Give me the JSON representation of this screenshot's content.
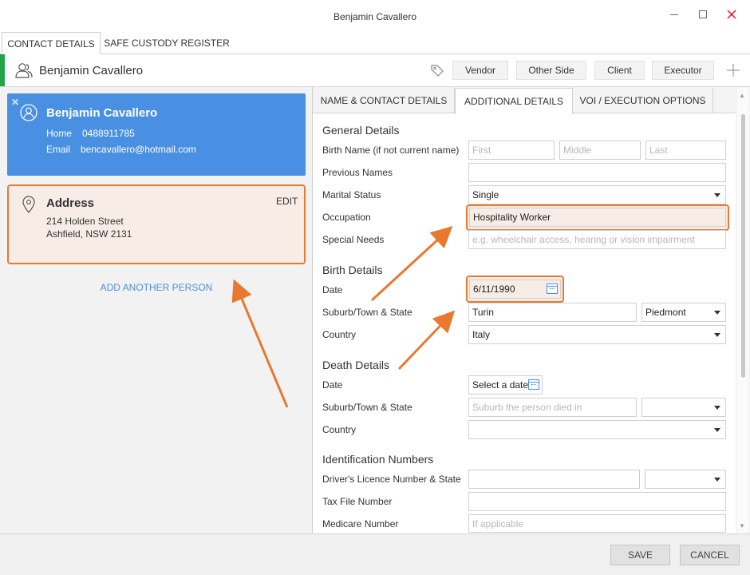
{
  "window": {
    "title": "Benjamin Cavallero",
    "minimize_icon": "minimize-icon",
    "maximize_icon": "maximize-icon",
    "close_icon": "close-icon",
    "close_color": "#e81123"
  },
  "top_tabs": [
    {
      "label": "CONTACT DETAILS",
      "active": true
    },
    {
      "label": "SAFE CUSTODY REGISTER",
      "active": false
    }
  ],
  "person_header": {
    "icon": "people-icon",
    "name": "Benjamin Cavallero",
    "accent_color": "#22a447",
    "tag_icon": "tag-icon",
    "roles": [
      "Vendor",
      "Other Side",
      "Client",
      "Executor"
    ],
    "add_icon": "plus-icon"
  },
  "contact_card": {
    "icon": "user-circle-icon",
    "remove_icon": "close-icon",
    "name": "Benjamin Cavallero",
    "home_label": "Home",
    "home_value": "0488911785",
    "email_label": "Email",
    "email_value": "bencavallero@hotmail.com",
    "color": "#4a90e2"
  },
  "address_card": {
    "icon": "map-pin-icon",
    "title": "Address",
    "edit_label": "EDIT",
    "line1": "214 Holden Street",
    "line2": "Ashfield, NSW 2131"
  },
  "add_another_person": "ADD ANOTHER PERSON",
  "sub_tabs": [
    {
      "label": "NAME & CONTACT DETAILS",
      "active": false
    },
    {
      "label": "ADDITIONAL DETAILS",
      "active": true
    },
    {
      "label": "VOI / EXECUTION OPTIONS",
      "active": false
    }
  ],
  "general": {
    "heading": "General Details",
    "birth_name_label": "Birth Name (if not current name)",
    "first_placeholder": "First",
    "middle_placeholder": "Middle",
    "last_placeholder": "Last",
    "previous_names_label": "Previous Names",
    "previous_names_value": "",
    "marital_status_label": "Marital Status",
    "marital_status_value": "Single",
    "occupation_label": "Occupation",
    "occupation_value": "Hospitality Worker",
    "special_needs_label": "Special Needs",
    "special_needs_placeholder": "e.g. wheelchair access, hearing or vision impairment"
  },
  "birth": {
    "heading": "Birth Details",
    "date_label": "Date",
    "date_value": "6/11/1990",
    "suburb_label": "Suburb/Town & State",
    "suburb_value": "Turin",
    "state_value": "Piedmont",
    "country_label": "Country",
    "country_value": "Italy"
  },
  "death": {
    "heading": "Death Details",
    "date_label": "Date",
    "date_button": "Select a date",
    "suburb_label": "Suburb/Town & State",
    "suburb_placeholder": "Suburb the person died in",
    "state_value": "",
    "country_label": "Country",
    "country_value": ""
  },
  "identification": {
    "heading": "Identification Numbers",
    "licence_label": "Driver's Licence Number & State",
    "licence_value": "",
    "licence_state": "",
    "tfn_label": "Tax File Number",
    "tfn_value": "",
    "medicare_label": "Medicare Number",
    "medicare_placeholder": "If applicable"
  },
  "footer": {
    "save_label": "SAVE",
    "cancel_label": "CANCEL"
  },
  "annotations": {
    "highlight_color": "#e8792f"
  }
}
